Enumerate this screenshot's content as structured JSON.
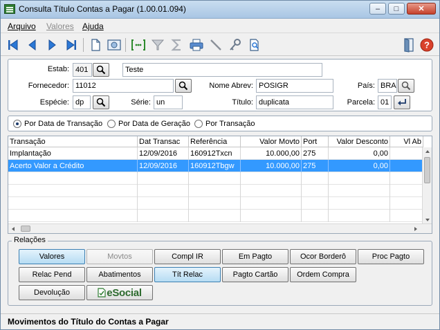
{
  "window": {
    "title": "Consulta Título Contas a Pagar (1.00.01.094)",
    "minimize": "–",
    "maximize": "□",
    "close": "✕"
  },
  "menu": [
    {
      "label": "Arquivo",
      "enabled": true
    },
    {
      "label": "Valores",
      "enabled": false
    },
    {
      "label": "Ajuda",
      "enabled": true
    }
  ],
  "toolbar": {
    "icons": [
      "first-icon",
      "previous-icon",
      "next-icon",
      "last-icon",
      "new-document-icon",
      "view-icon",
      "goto-icon",
      "filter-icon",
      "sum-icon",
      "print-icon",
      "pen-icon",
      "key-icon",
      "search-document-icon",
      "exit-icon",
      "help-icon"
    ],
    "help_label": "?"
  },
  "form": {
    "estab_label": "Estab:",
    "estab_value": "401",
    "estab_name": "Teste",
    "fornecedor_label": "Fornecedor:",
    "fornecedor_value": "11012",
    "nome_abrev_label": "Nome Abrev:",
    "nome_abrev_value": "POSIGR",
    "pais_label": "País:",
    "pais_value": "BRA",
    "especie_label": "Espécie:",
    "especie_value": "dp",
    "serie_label": "Série:",
    "serie_value": "un",
    "titulo_label": "Título:",
    "titulo_value": "duplicata",
    "parcela_label": "Parcela:",
    "parcela_value": "01"
  },
  "radios": [
    {
      "label": "Por Data de Transação",
      "checked": true
    },
    {
      "label": "Por Data de Geração",
      "checked": false
    },
    {
      "label": "Por Transação",
      "checked": false
    }
  ],
  "grid": {
    "columns": [
      "Transação",
      "Dat Transac",
      "Referência",
      "Valor Movto",
      "Port",
      "Valor Desconto",
      "Vl Ab"
    ],
    "rows": [
      {
        "transacao": "Implantação",
        "data": "12/09/2016",
        "referencia": "160912Txcn",
        "valor": "10.000,00",
        "port": "275",
        "desconto": "0,00",
        "vlab": "",
        "selected": false
      },
      {
        "transacao": "Acerto Valor a Crédito",
        "data": "12/09/2016",
        "referencia": "160912Tbgw",
        "valor": "10.000,00",
        "port": "275",
        "desconto": "0,00",
        "vlab": "",
        "selected": true
      }
    ]
  },
  "relacoes": {
    "title": "Relações",
    "buttons": [
      {
        "label": "Valores",
        "state": "active"
      },
      {
        "label": "Movtos",
        "state": "disabled"
      },
      {
        "label": "Compl IR",
        "state": "normal"
      },
      {
        "label": "Em Pagto",
        "state": "normal"
      },
      {
        "label": "Ocor Borderô",
        "state": "normal"
      },
      {
        "label": "Proc Pagto",
        "state": "normal"
      },
      {
        "label": "Relac Pend",
        "state": "normal"
      },
      {
        "label": "Abatimentos",
        "state": "normal"
      },
      {
        "label": "Tít Relac",
        "state": "active"
      },
      {
        "label": "Pagto Cartão",
        "state": "normal"
      },
      {
        "label": "Ordem Compra",
        "state": "normal"
      },
      {
        "label": "Devolução",
        "state": "normal"
      }
    ],
    "esocial_label": "eSocial"
  },
  "status": {
    "text": "Movimentos do Título do Contas a Pagar"
  }
}
